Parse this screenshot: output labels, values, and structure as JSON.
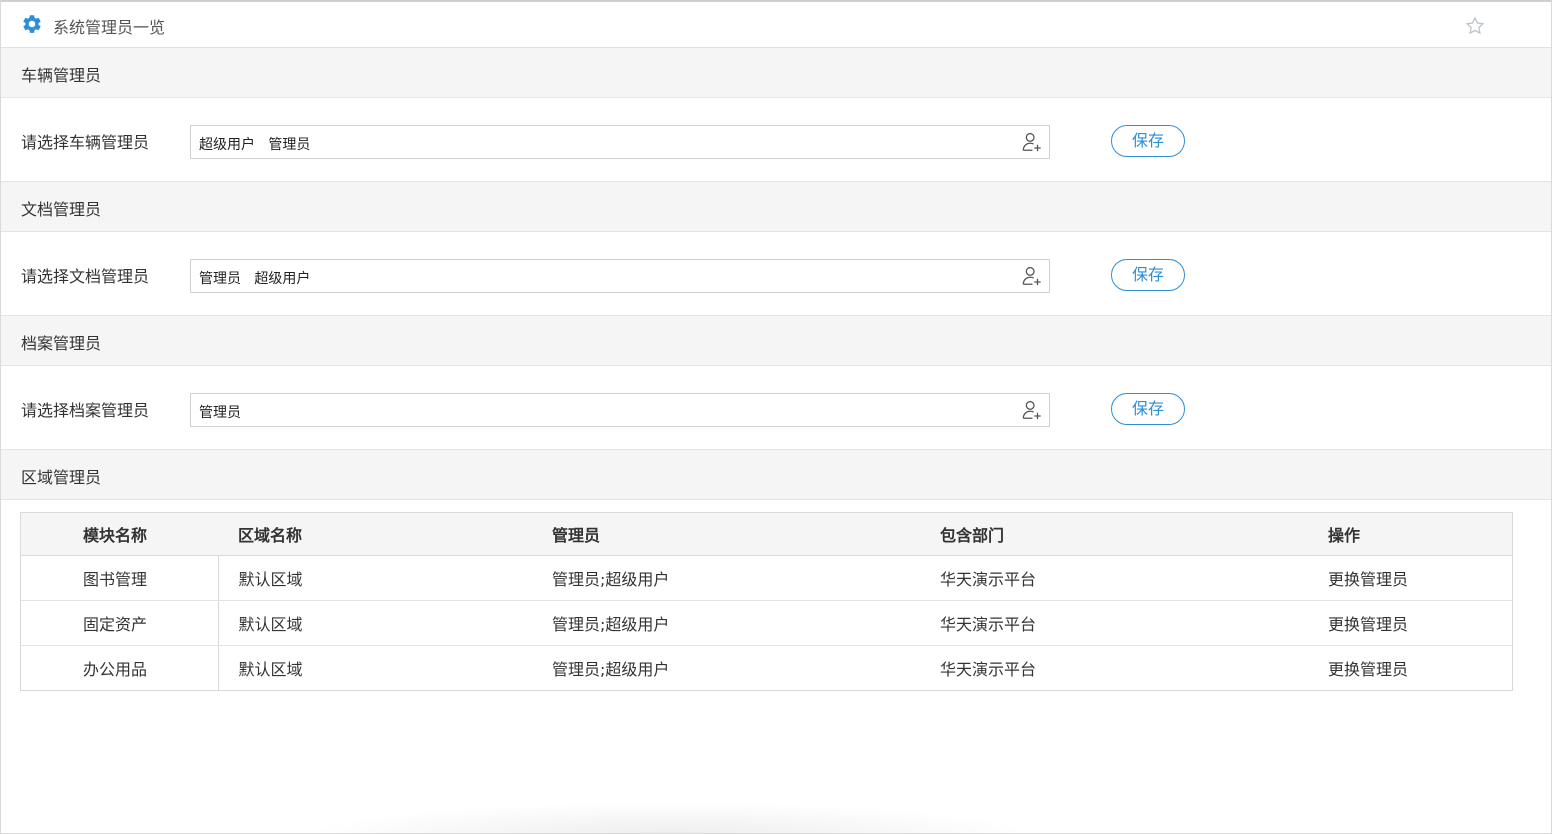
{
  "header": {
    "title": "系统管理员一览",
    "icon": "gear-icon",
    "accent_color": "#2c8ed6"
  },
  "sections": [
    {
      "heading": "车辆管理员",
      "label": "请选择车辆管理员",
      "value": "超级用户   管理员",
      "save_label": "保存"
    },
    {
      "heading": "文档管理员",
      "label": "请选择文档管理员",
      "value": "管理员   超级用户",
      "save_label": "保存"
    },
    {
      "heading": "档案管理员",
      "label": "请选择档案管理员",
      "value": "管理员",
      "save_label": "保存"
    }
  ],
  "region": {
    "heading": "区域管理员",
    "columns": [
      "模块名称",
      "区域名称",
      "管理员",
      "包含部门",
      "操作"
    ],
    "rows": [
      [
        "图书管理",
        "默认区域",
        "管理员;超级用户",
        "华天演示平台",
        "更换管理员"
      ],
      [
        "固定资产",
        "默认区域",
        "管理员;超级用户",
        "华天演示平台",
        "更换管理员"
      ],
      [
        "办公用品",
        "默认区域",
        "管理员;超级用户",
        "华天演示平台",
        "更换管理员"
      ]
    ]
  }
}
